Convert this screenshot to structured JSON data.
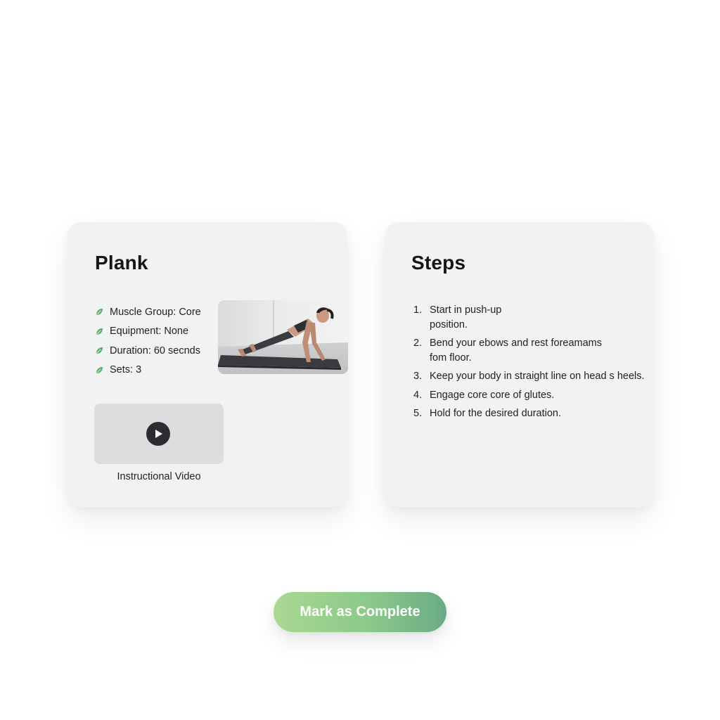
{
  "exercise": {
    "title": "Plank",
    "details": [
      {
        "icon": "leaf-icon",
        "text": "Muscle Group: Core"
      },
      {
        "icon": "leaf-icon",
        "text": "Equipment: None"
      },
      {
        "icon": "leaf-icon",
        "text": "Duration: 60 secnds"
      },
      {
        "icon": "leaf-icon",
        "text": "Sets: 3"
      }
    ],
    "video_label": "Instructional Video"
  },
  "steps": {
    "title": "Steps",
    "items": [
      {
        "num": "1.",
        "text": "Start in push-up\nposition."
      },
      {
        "num": "2.",
        "text": "Bend your ebows and rest foreamams\nfom floor."
      },
      {
        "num": "3.",
        "text": "Keep your body in straight line on head s heels."
      },
      {
        "num": "4.",
        "text": "Engage core core of glutes."
      },
      {
        "num": "5.",
        "text": "Hold for the desired duration."
      }
    ]
  },
  "actions": {
    "complete_label": "Mark as Complete"
  },
  "colors": {
    "accent_green": "#6aab85",
    "leaf_green": "#5fae6e",
    "card_bg": "#f1f2f3"
  }
}
